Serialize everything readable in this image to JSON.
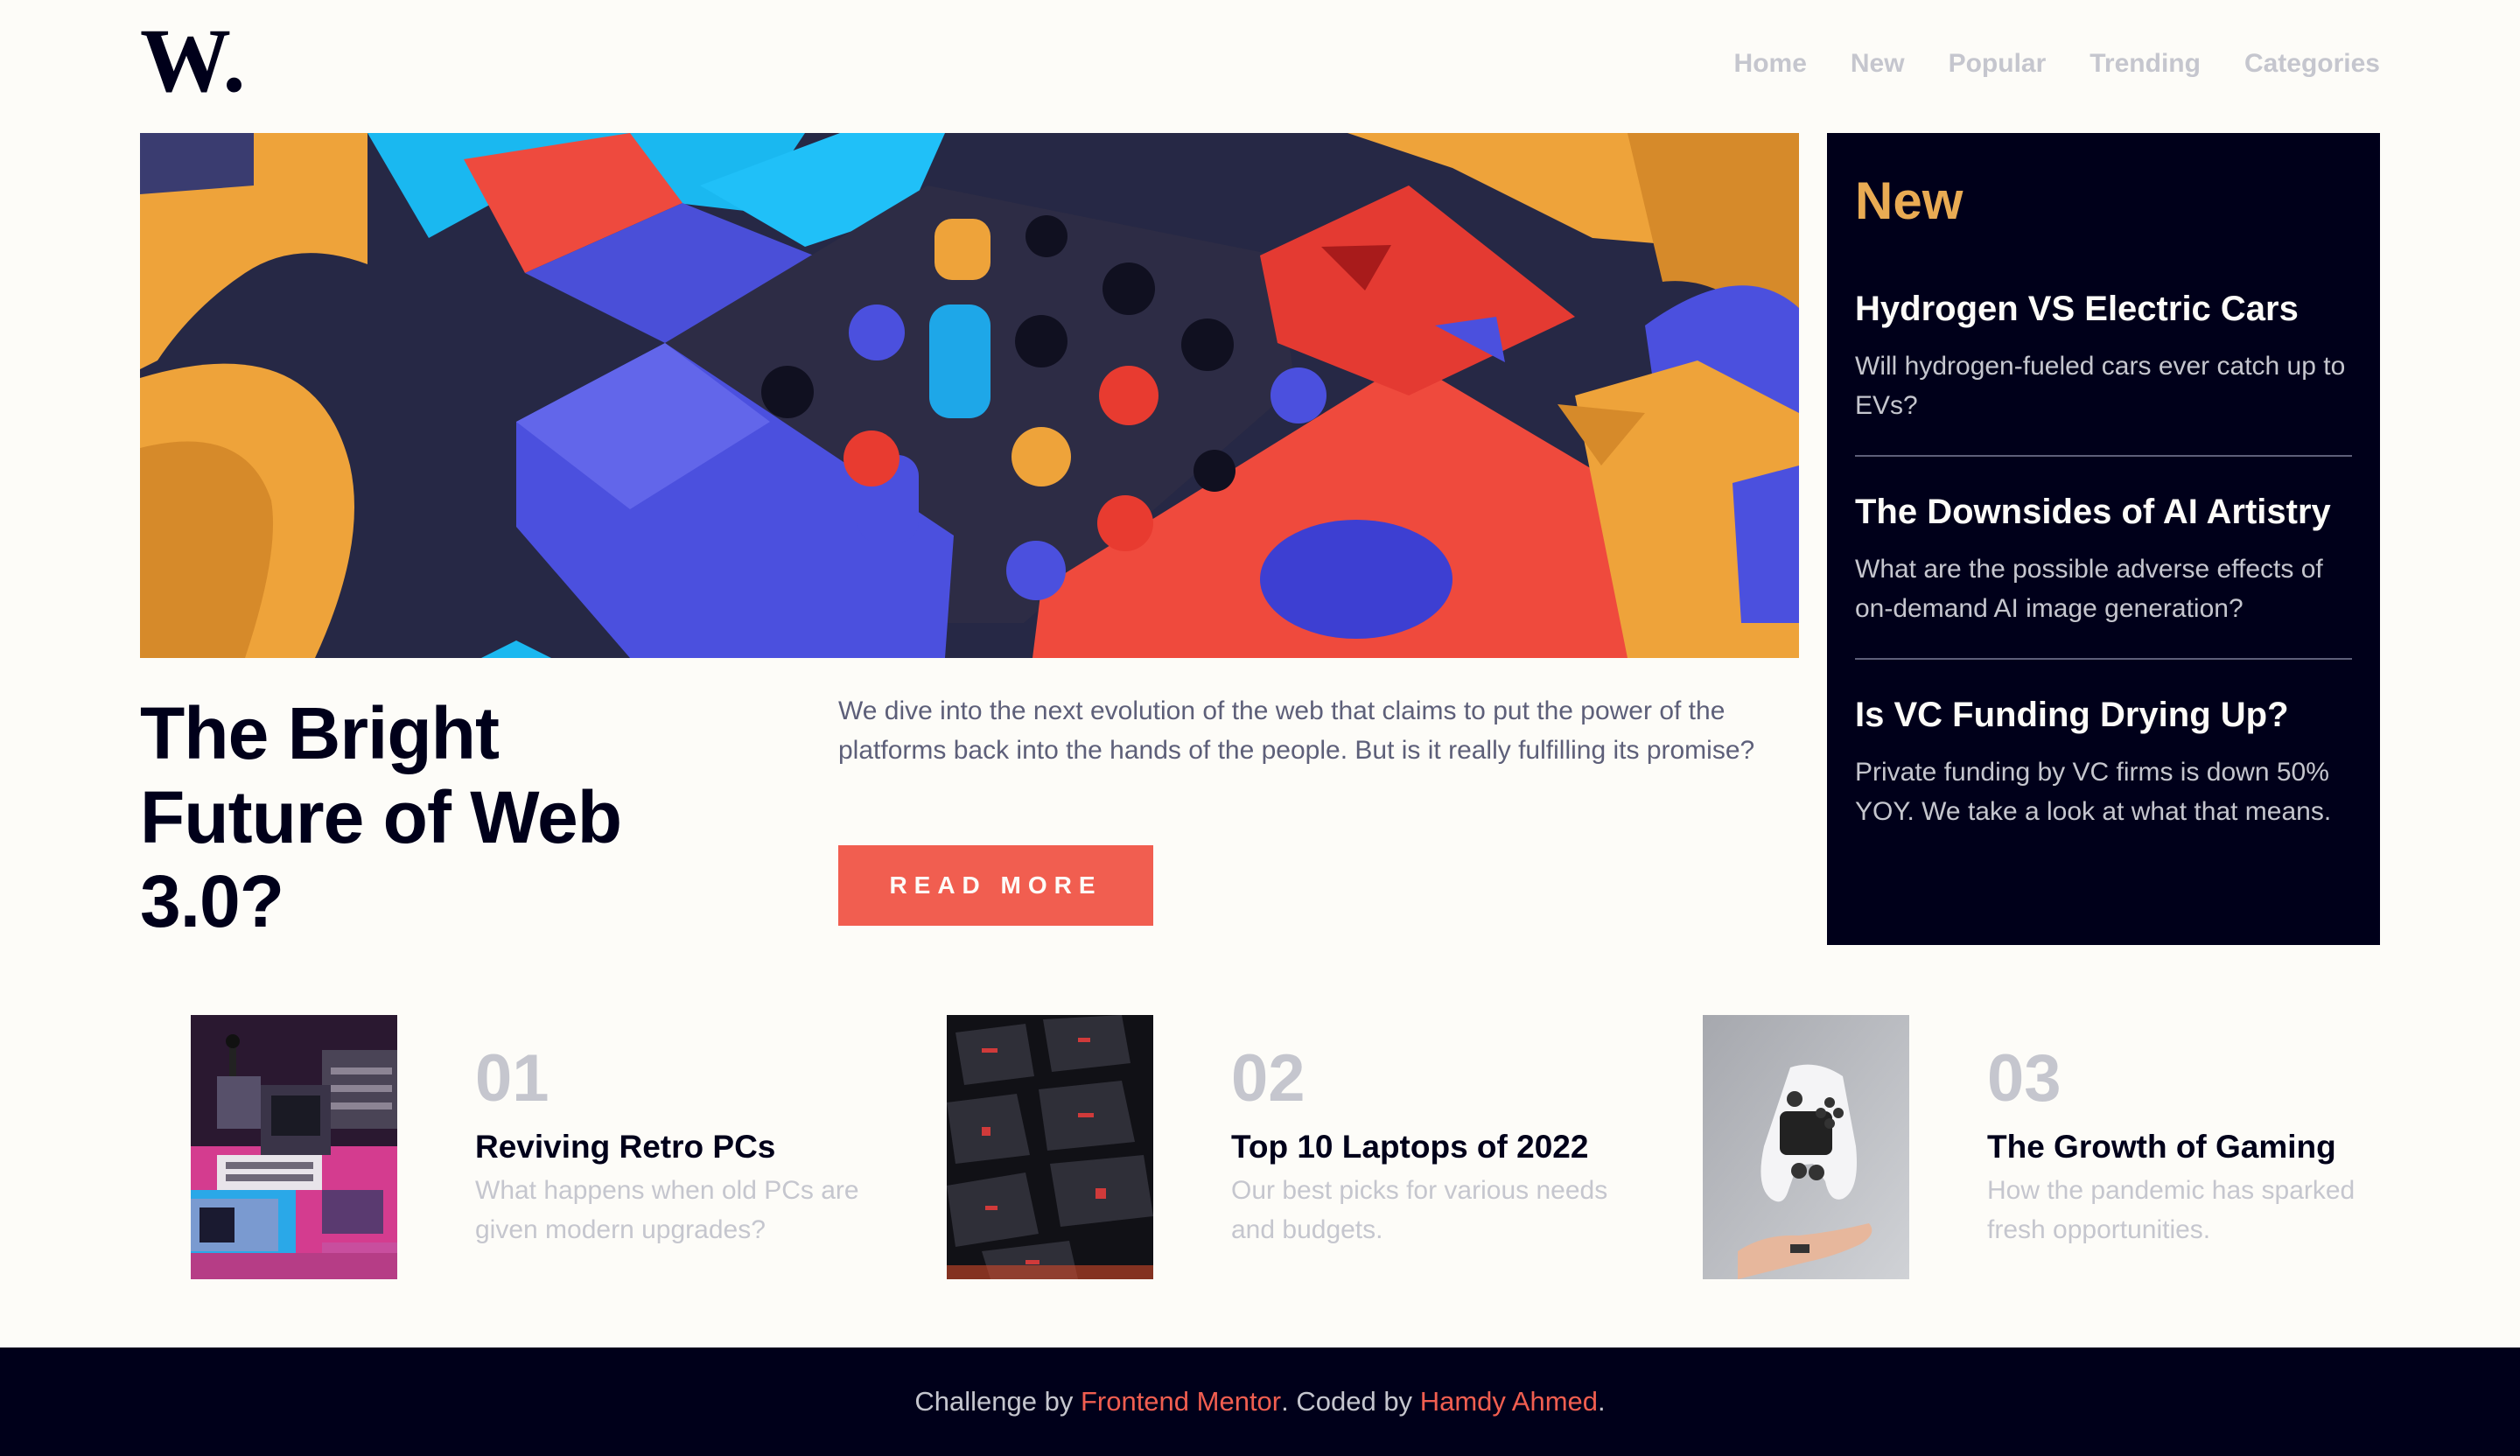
{
  "header": {
    "logo": "W.",
    "nav": [
      "Home",
      "New",
      "Popular",
      "Trending",
      "Categories"
    ]
  },
  "hero": {
    "title": "The Bright Future of Web 3.0?",
    "description": "We dive into the next evolution of the web that claims to put the power of the platforms back into the hands of the people. But is it really fulfilling its promise?",
    "button": "READ MORE"
  },
  "new_panel": {
    "heading": "New",
    "items": [
      {
        "title": "Hydrogen VS Electric Cars",
        "desc": "Will hydrogen-fueled cars ever catch up to EVs?"
      },
      {
        "title": "The Downsides of AI Artistry",
        "desc": "What are the possible adverse effects of on-demand AI image generation?"
      },
      {
        "title": "Is VC Funding Drying Up?",
        "desc": "Private funding by VC firms is down 50% YOY. We take a look at what that means."
      }
    ]
  },
  "articles": [
    {
      "num": "01",
      "title": "Reviving Retro PCs",
      "desc": "What happens when old PCs are given modern upgrades?"
    },
    {
      "num": "02",
      "title": "Top 10 Laptops of 2022",
      "desc": "Our best picks for various needs and budgets."
    },
    {
      "num": "03",
      "title": "The Growth of Gaming",
      "desc": "How the pandemic has sparked fresh opportunities."
    }
  ],
  "footer": {
    "prefix": "Challenge by ",
    "link1": "Frontend Mentor",
    "middle": ". Coded by ",
    "link2": "Hamdy Ahmed",
    "suffix": "."
  },
  "colors": {
    "accent_red": "#f15e50",
    "accent_orange": "#e9ab53",
    "dark_navy": "#00001a",
    "grayish_blue": "#5d5f79",
    "grayish_light": "#c5c6ce",
    "off_white": "#fdfcf8"
  }
}
